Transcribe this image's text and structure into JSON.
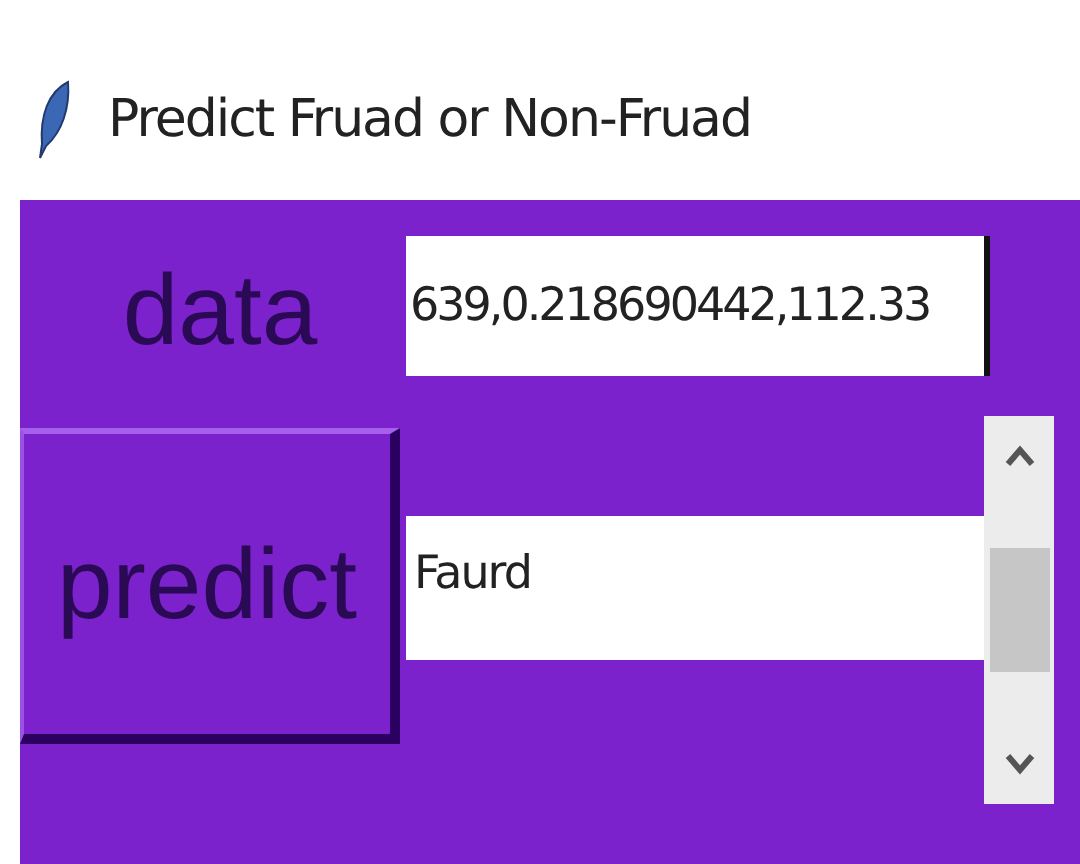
{
  "window": {
    "title": "Predict Fruad or Non-Fruad"
  },
  "data_label": "data",
  "data_field": {
    "value": "639,0.218690442,112.33"
  },
  "predict_button": "predict",
  "result": {
    "value": "Faurd"
  }
}
